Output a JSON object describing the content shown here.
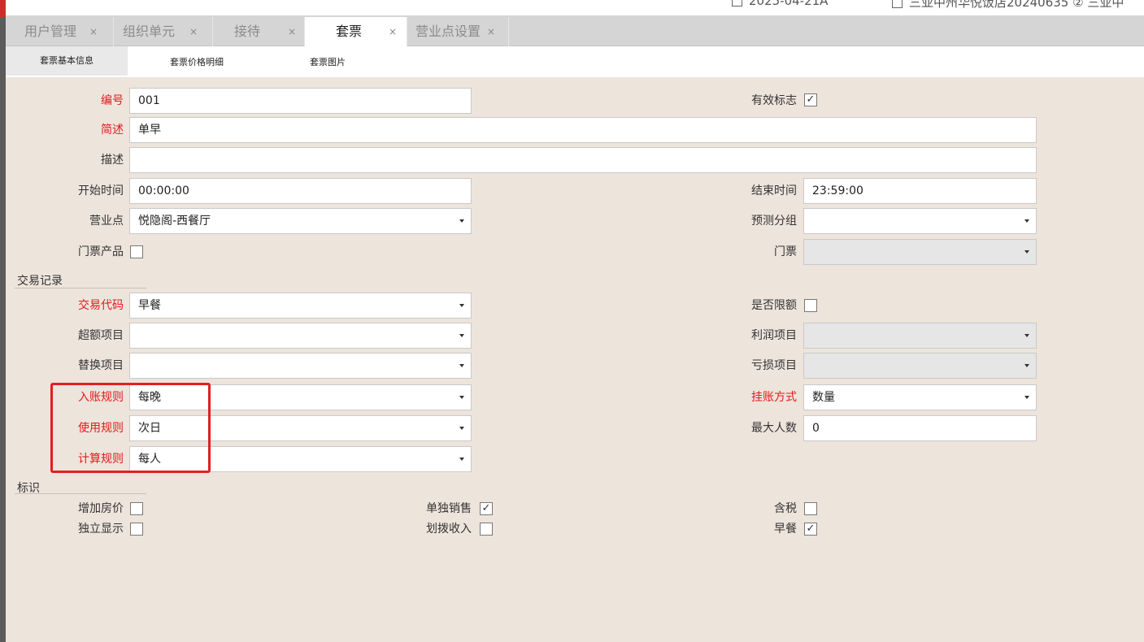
{
  "header": {
    "date": "2025-04-21A",
    "hotel": "三亚中州华悦饭店20240635 ② 三亚中"
  },
  "tabs": [
    {
      "label": "用户管理",
      "close": "×"
    },
    {
      "label": "组织单元",
      "close": "×"
    },
    {
      "label": "接待",
      "close": "×"
    },
    {
      "label": "套票",
      "close": "×"
    },
    {
      "label": "营业点设置",
      "close": "×"
    }
  ],
  "subtabs": [
    "套票基本信息",
    "套票价格明细",
    "套票图片"
  ],
  "form": {
    "code": {
      "label": "编号",
      "value": "001"
    },
    "valid_flag": {
      "label": "有效标志",
      "checked": true
    },
    "short_desc": {
      "label": "简述",
      "value": "单早"
    },
    "description": {
      "label": "描述",
      "value": ""
    },
    "start_time": {
      "label": "开始时间",
      "value": "00:00:00"
    },
    "end_time": {
      "label": "结束时间",
      "value": "23:59:00"
    },
    "outlet": {
      "label": "营业点",
      "value": "悦隐阁-西餐厅"
    },
    "forecast_group": {
      "label": "预测分组",
      "value": ""
    },
    "ticket_product": {
      "label": "门票产品",
      "checked": false
    },
    "ticket": {
      "label": "门票",
      "value": ""
    }
  },
  "transaction": {
    "title": "交易记录",
    "code": {
      "label": "交易代码",
      "value": "早餐"
    },
    "limit": {
      "label": "是否限额",
      "checked": false
    },
    "excess_item": {
      "label": "超额项目",
      "value": ""
    },
    "profit_item": {
      "label": "利润项目",
      "value": ""
    },
    "replace_item": {
      "label": "替换项目",
      "value": ""
    },
    "loss_item": {
      "label": "亏损项目",
      "value": ""
    },
    "posting_rule": {
      "label": "入账规则",
      "value": "每晚"
    },
    "charge_method": {
      "label": "挂账方式",
      "value": "数量"
    },
    "usage_rule": {
      "label": "使用规则",
      "value": "次日"
    },
    "max_people": {
      "label": "最大人数",
      "value": "0"
    },
    "calc_rule": {
      "label": "计算规则",
      "value": "每人"
    }
  },
  "flags": {
    "title": "标识",
    "add_room_rate": {
      "label": "增加房价",
      "checked": false
    },
    "sell_separately": {
      "label": "单独销售",
      "checked": true
    },
    "tax_included": {
      "label": "含税",
      "checked": false
    },
    "separate_display": {
      "label": "独立显示",
      "checked": false
    },
    "transfer_income": {
      "label": "划拨收入",
      "checked": false
    },
    "breakfast": {
      "label": "早餐",
      "checked": true
    }
  },
  "checkmark": "✓",
  "colors": {
    "required_label": "#e01b1b",
    "highlight_border": "#e02020",
    "background": "#ede4dc"
  }
}
